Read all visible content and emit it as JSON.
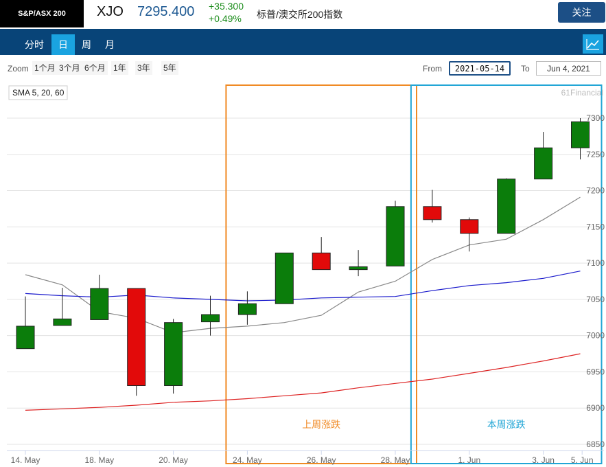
{
  "header": {
    "index_badge": "S&P/ASX 200",
    "symbol": "XJO",
    "price": "7295.400",
    "change_abs": "+35.300",
    "change_pct": "+0.49%",
    "index_name": "标普/澳交所200指数",
    "follow_button": "关注"
  },
  "tabs": [
    {
      "label": "分时",
      "active": false
    },
    {
      "label": "日",
      "active": true
    },
    {
      "label": "周",
      "active": false
    },
    {
      "label": "月",
      "active": false
    }
  ],
  "chart_type_icon": "line-chart-icon",
  "toolbar": {
    "zoom_label": "Zoom",
    "zoom_options": [
      "1个月",
      "3个月",
      "6个月",
      "1年",
      "3年",
      "5年"
    ],
    "from_label": "From",
    "from_value": "2021-05-14",
    "to_label": "To",
    "to_value": "Jun 4, 2021"
  },
  "chart_data": {
    "type": "candlestick",
    "legend_text": "SMA 5, 20, 60",
    "watermark": "61Financial",
    "ylim": [
      6840,
      7330
    ],
    "y_ticks": [
      7300,
      7250,
      7200,
      7150,
      7100,
      7050,
      7000,
      6950,
      6900,
      6850
    ],
    "grid": true,
    "x_tick_labels": [
      {
        "label": "14. May",
        "index": 0
      },
      {
        "label": "18. May",
        "index": 2
      },
      {
        "label": "20. May",
        "index": 4
      },
      {
        "label": "24. May",
        "index": 6
      },
      {
        "label": "26. May",
        "index": 8
      },
      {
        "label": "28. May",
        "index": 10
      },
      {
        "label": "1. Jun",
        "index": 12
      },
      {
        "label": "3. Jun",
        "index": 14
      },
      {
        "label": "5. Jun",
        "index": 15.05
      }
    ],
    "candles": [
      {
        "open": 6982,
        "close": 7013,
        "high": 7054,
        "low": 6982
      },
      {
        "open": 7014,
        "close": 7023,
        "high": 7066,
        "low": 7014
      },
      {
        "open": 7022,
        "close": 7065,
        "high": 7084,
        "low": 7022
      },
      {
        "open": 7065,
        "close": 6931,
        "high": 7065,
        "low": 6917
      },
      {
        "open": 6931,
        "close": 7018,
        "high": 7023,
        "low": 6920
      },
      {
        "open": 7019,
        "close": 7029,
        "high": 7055,
        "low": 7000
      },
      {
        "open": 7029,
        "close": 7044,
        "high": 7061,
        "low": 7015
      },
      {
        "open": 7044,
        "close": 7114,
        "high": 7114,
        "low": 7044
      },
      {
        "open": 7114,
        "close": 7091,
        "high": 7136,
        "low": 7091
      },
      {
        "open": 7091,
        "close": 7095,
        "high": 7118,
        "low": 7082
      },
      {
        "open": 7096,
        "close": 7178,
        "high": 7186,
        "low": 7096
      },
      {
        "open": 7178,
        "close": 7160,
        "high": 7201,
        "low": 7156
      },
      {
        "open": 7160,
        "close": 7141,
        "high": 7163,
        "low": 7116
      },
      {
        "open": 7141,
        "close": 7216,
        "high": 7217,
        "low": 7141
      },
      {
        "open": 7216,
        "close": 7259,
        "high": 7281,
        "low": 7216
      },
      {
        "open": 7259,
        "close": 7295,
        "high": 7300,
        "low": 7243
      }
    ],
    "series": [
      {
        "color": "#888888",
        "values": [
          7084,
          7070,
          7033,
          7024,
          7004,
          7010,
          7013,
          7018,
          7028,
          7060,
          7075,
          7105,
          7125,
          7133,
          7160,
          7191
        ]
      },
      {
        "color": "#1a1acc",
        "values": [
          7058,
          7055,
          7053,
          7056,
          7052,
          7050,
          7048,
          7049,
          7052,
          7053,
          7054,
          7062,
          7069,
          7073,
          7079,
          7089
        ]
      },
      {
        "color": "#dd2222",
        "values": [
          6897,
          6899,
          6901,
          6904,
          6908,
          6910,
          6913,
          6917,
          6921,
          6928,
          6934,
          6940,
          6948,
          6956,
          6965,
          6975
        ]
      }
    ],
    "annotations": [
      {
        "label": "上周涨跌",
        "color": "#f08a24",
        "from_index": 6,
        "to_index": 10
      },
      {
        "label": "本周涨跌",
        "color": "#22a6d6",
        "from_index": 11,
        "to_index": 15
      }
    ],
    "colors": {
      "up": "#0b7d0b",
      "down": "#e20a0a"
    }
  }
}
